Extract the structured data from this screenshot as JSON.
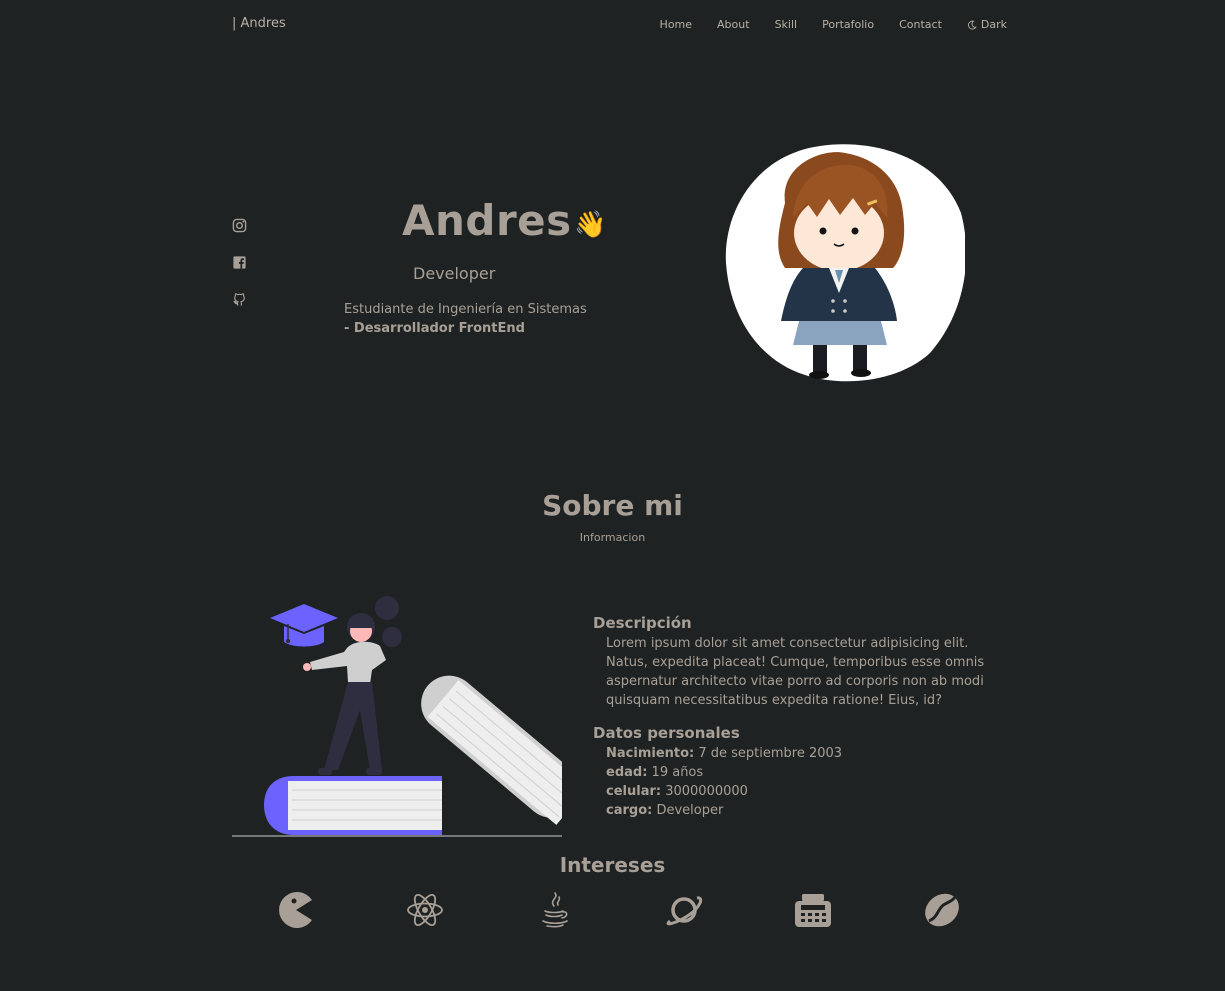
{
  "nav": {
    "brand": "| Andres",
    "links": [
      "Home",
      "About",
      "Skill",
      "Portafolio",
      "Contact"
    ],
    "theme_label": "Dark"
  },
  "socials": [
    "instagram-icon",
    "facebook-icon",
    "github-icon"
  ],
  "hero": {
    "name": "Andres",
    "wave": "👋",
    "role": "Developer",
    "desc_line1": "Estudiante de Ingeniería en Sistemas",
    "desc_line2": "- Desarrollador FrontEnd"
  },
  "about": {
    "title": "Sobre mi",
    "subtitle": "Informacion",
    "description_heading": "Descripción",
    "description": "Lorem ipsum dolor sit amet consectetur adipisicing elit. Natus, expedita placeat! Cumque, temporibus esse omnis aspernatur architecto vitae porro ad corporis non ab modi quisquam necessitatibus expedita ratione! Eius, id?",
    "personal_heading": "Datos personales",
    "personal": [
      {
        "label": "Nacimiento:",
        "value": "7 de septiembre 2003"
      },
      {
        "label": "edad:",
        "value": "19 años"
      },
      {
        "label": "celular:",
        "value": "3000000000"
      },
      {
        "label": "cargo:",
        "value": "Developer"
      }
    ]
  },
  "interests": {
    "title": "Intereses",
    "icons": [
      "pacman-icon",
      "react-atom-icon",
      "java-icon",
      "planet-icon",
      "calculator-icon",
      "coffee-bean-icon"
    ]
  },
  "colors": {
    "background": "#1f2223",
    "text": "#a8a096",
    "accent": "#6c63ff"
  }
}
